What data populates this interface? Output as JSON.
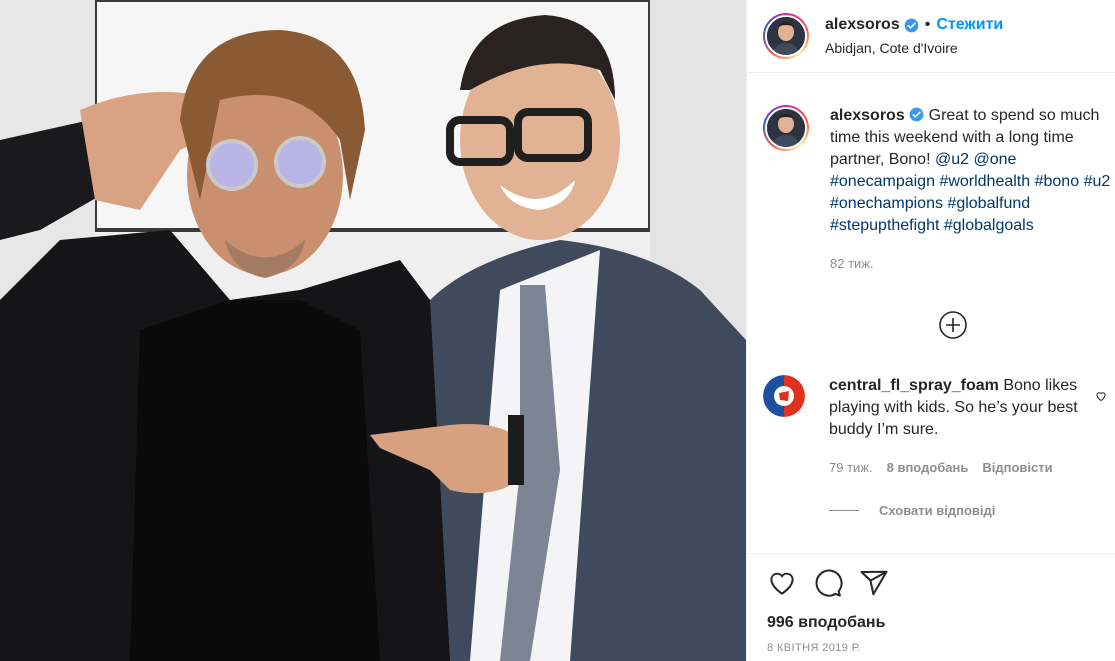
{
  "post": {
    "author": "alexsoros",
    "follow_label": "Стежити",
    "dot": "•",
    "location": "Abidjan, Cote d'Ivoire"
  },
  "caption": {
    "username": "alexsoros",
    "text": "Great to spend so much time this weekend with a long time partner, Bono!",
    "mentions": [
      "@u2",
      "@one"
    ],
    "hashtags": [
      "#onecampaign",
      "#worldhealth",
      "#bono",
      "#u2",
      "#onechampions",
      "#globalfund",
      "#stepupthefight",
      "#globalgoals"
    ],
    "time": "82 тиж."
  },
  "comment": {
    "username": "central_fl_spray_foam",
    "text": "Bono likes playing with kids. So he’s your best buddy I’m sure.",
    "time": "79 тиж.",
    "likes": "8 вподобань",
    "reply_label": "Відповісти",
    "hide_replies": "Сховати відповіді"
  },
  "actions": {
    "likes": "996 вподобань",
    "date": "8 КВІТНЯ 2019 Р."
  },
  "icons": {
    "verified": "verified-badge-icon",
    "load_more": "plus-circle-icon",
    "like": "heart-icon",
    "comment": "comment-bubble-icon",
    "share": "paper-plane-icon"
  },
  "colors": {
    "link": "#00376b",
    "follow": "#0095f6",
    "verified": "#3897f0",
    "muted": "#8e8e8e"
  }
}
